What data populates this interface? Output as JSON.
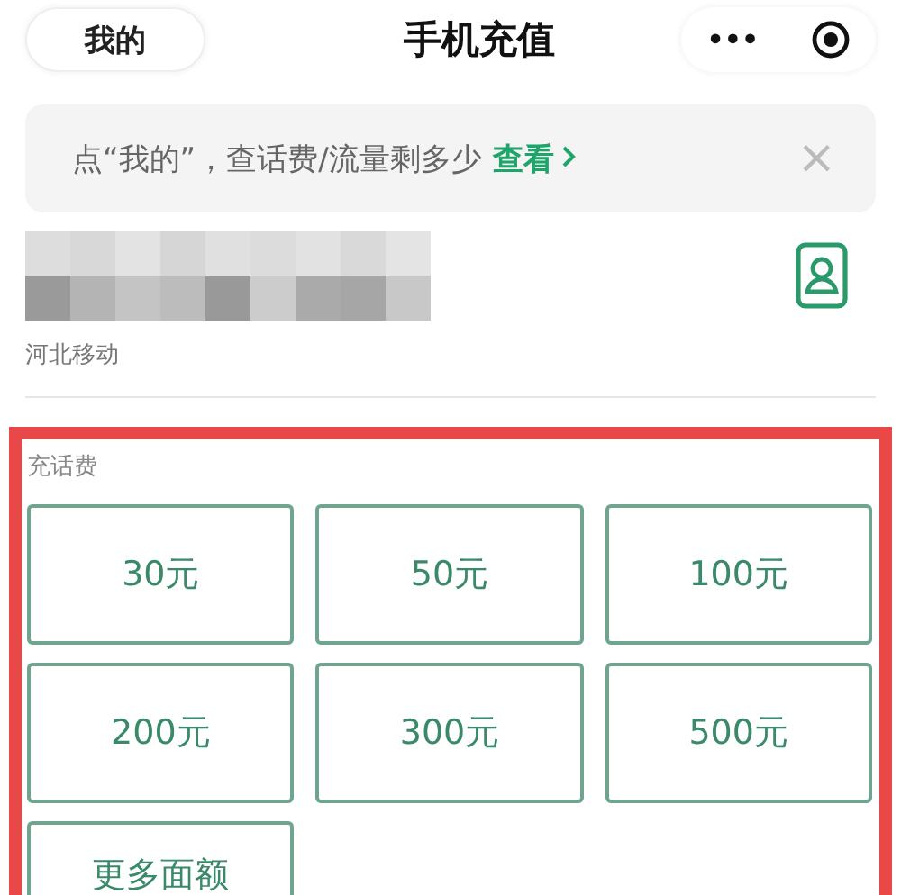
{
  "nav_bar": {
    "back_label": "我的",
    "title": "手机充值",
    "more_glyph": "•••"
  },
  "banner": {
    "text": "点“我的”，查话费/流量剩多少",
    "link": "查看",
    "close_glyph": "×"
  },
  "account": {
    "carrier": "河北移动"
  },
  "recharge": {
    "section_label": "充话费",
    "options": [
      {
        "label": "30元"
      },
      {
        "label": "50元"
      },
      {
        "label": "100元"
      },
      {
        "label": "200元"
      },
      {
        "label": "300元"
      },
      {
        "label": "500元"
      },
      {
        "label": "更多面额"
      }
    ]
  }
}
